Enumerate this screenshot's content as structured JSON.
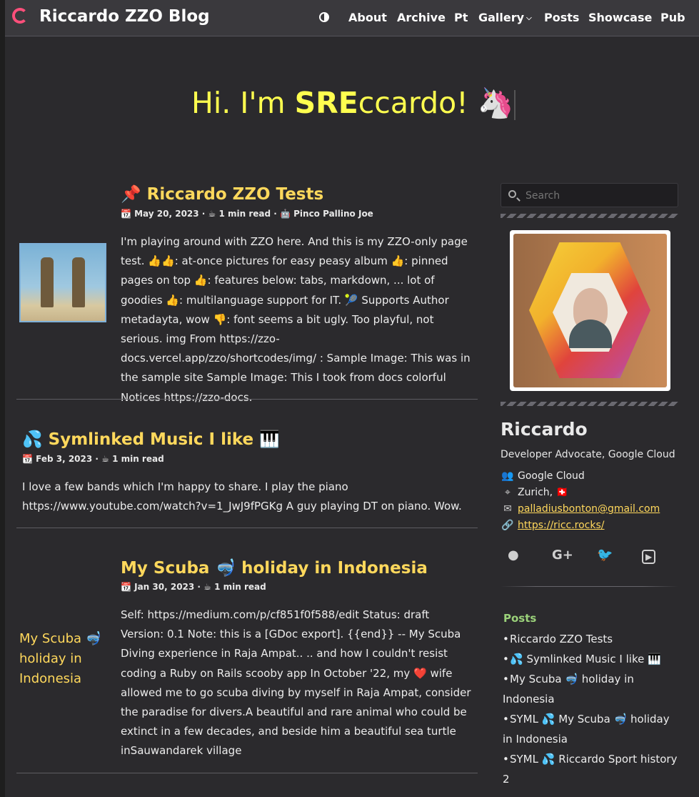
{
  "navbar": {
    "site_title": "Riccardo ZZO Blog",
    "items": [
      "About",
      "Archive",
      "Pt",
      "Gallery",
      "Posts",
      "Showcase",
      "Pub"
    ]
  },
  "hero": {
    "prefix": "Hi. I'm ",
    "bold": "SRE",
    "suffix": "ccardo! 🦄"
  },
  "posts": [
    {
      "title": "📌 Riccardo ZZO Tests",
      "meta": "📆 May 20, 2023 · ☕ 1 min read · 🤖 Pinco Pallino Joe",
      "summary": "I'm playing around with ZZO here. And this is my ZZO-only page test. 👍👍: at-once pictures for easy peasy album 👍: pinned pages on top 👍: features below: tabs, markdown, ... lot of goodies 👍: multilanguage support for IT. 🎾 Supports Author metadayta, wow 👎: font seems a bit ugly. Too playful, not serious. img From https://zzo-docs.vercel.app/zzo/shortcodes/img/ : Sample Image: This was in the sample site Sample Image: This I took from docs colorful Notices https://zzo-docs."
    },
    {
      "title": "💦 Symlinked Music I like 🎹",
      "meta": "📆 Feb 3, 2023 · ☕ 1 min read",
      "summary": "I love a few bands which I'm happy to share. I play the piano https://www.youtube.com/watch?v=1_JwJ9fPGKg A guy playing DT on piano. Wow."
    },
    {
      "title": "My Scuba 🤿 holiday in Indonesia",
      "meta": "📆 Jan 30, 2023 · ☕ 1 min read",
      "summary": "Self: https://medium.com/p/cf851f0f588/edit Status: draft Version: 0.1 Note: this is a [GDoc export]. {{end}} -- My Scuba Diving experience in Raja Ampat.. .. and how I couldn't resist coding a Ruby on Rails scooby app In October '22, my ❤️ wife allowed me to go scuba diving by myself in Raja Ampat, consider the paradise for divers.A beautiful and rare animal who could be extinct in a few decades, and beside him a beautiful sea turtle inSauwandarek village",
      "image_alt": "My Scuba 🤿 holiday in Indonesia"
    }
  ],
  "sidebar": {
    "search_placeholder": "Search",
    "author_name": "Riccardo",
    "author_bio": "Developer Advocate, Google Cloud",
    "company": "Google Cloud",
    "location": "Zurich, 🇨🇭",
    "email": "palladiusbonton@gmail.com",
    "website": "https://ricc.rocks/",
    "social": [
      "github-icon",
      "google-plus-icon",
      "twitter-icon",
      "youtube-icon"
    ],
    "posts_heading": "Posts",
    "recent_posts": [
      "Riccardo ZZO Tests",
      "💦 Symlinked Music I like 🎹",
      "My Scuba 🤿 holiday in Indonesia",
      "SYML 💦 My Scuba 🤿 holiday in Indonesia",
      "SYML 💦 Riccardo Sport history 2"
    ]
  },
  "colors": {
    "accent_yellow": "#ffd85c",
    "hero_yellow": "#ffff4f",
    "logo_pink": "#ff4f7b",
    "posts_green": "#9bd27a",
    "background": "#2b2a2d"
  }
}
